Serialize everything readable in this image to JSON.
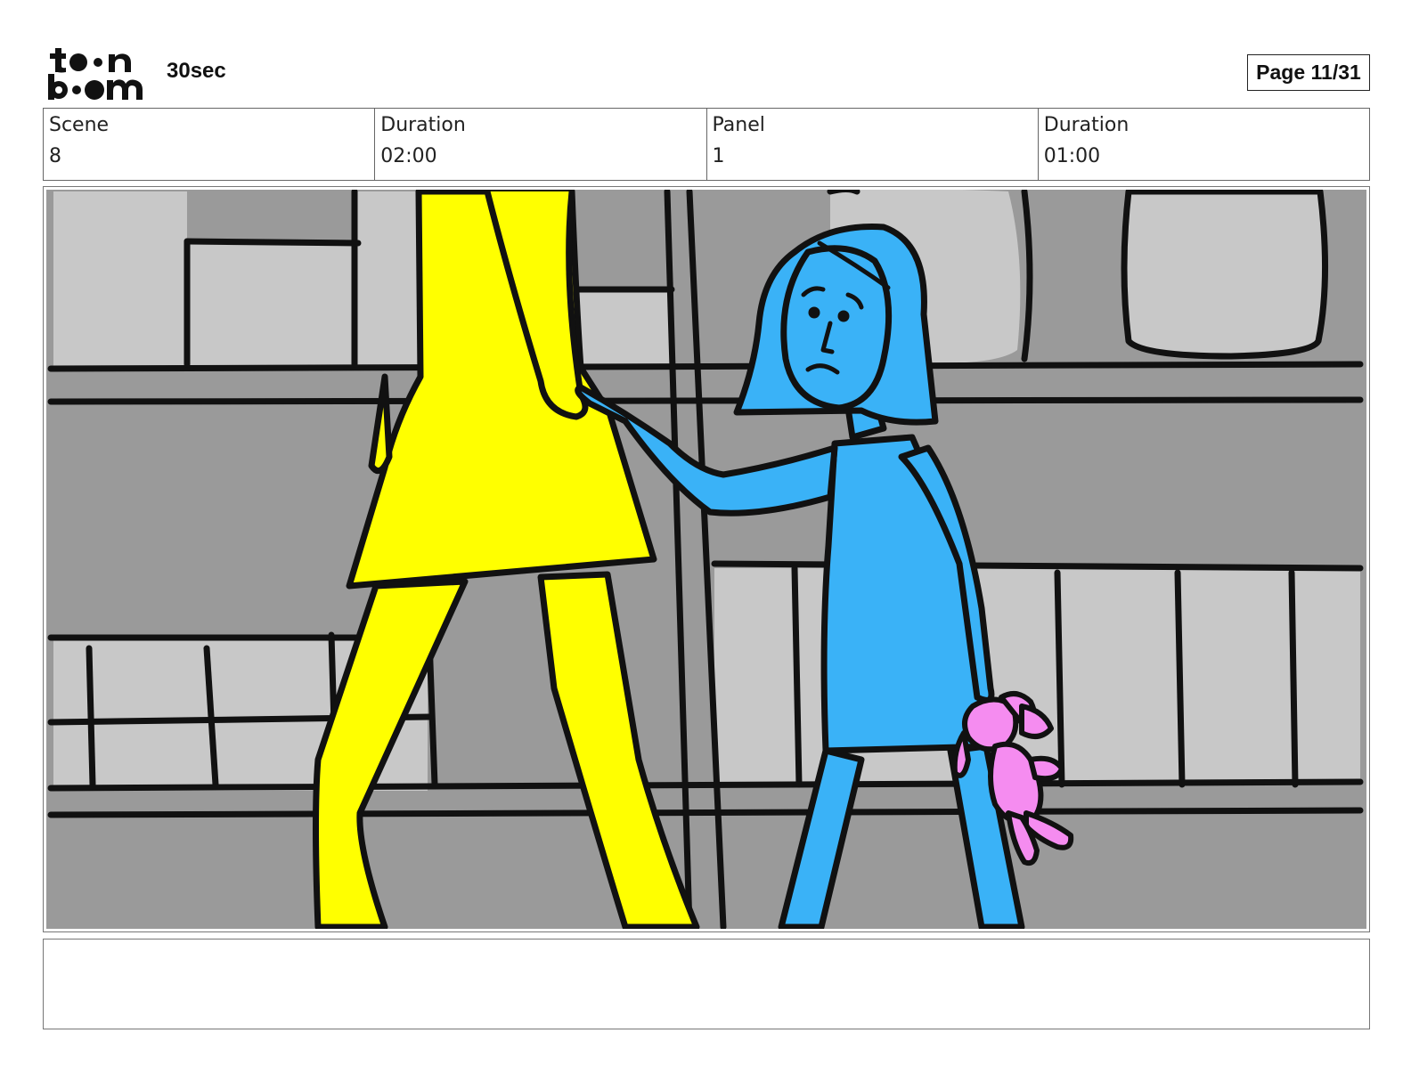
{
  "header": {
    "logo_text": "toon boom",
    "project_title": "30sec",
    "page_label": "Page 11/31"
  },
  "info": {
    "scene_label": "Scene",
    "scene_value": "8",
    "scene_duration_label": "Duration",
    "scene_duration_value": "02:00",
    "panel_label": "Panel",
    "panel_value": "1",
    "panel_duration_label": "Duration",
    "panel_duration_value": "01:00"
  },
  "panel": {
    "colors": {
      "background": "#9a9a9a",
      "shelf_light": "#c8c8c8",
      "woman_dress": "#ffff00",
      "girl": "#3ab2f7",
      "bunny": "#f58cf0",
      "ink": "#111111"
    }
  },
  "caption": {
    "text": ""
  }
}
